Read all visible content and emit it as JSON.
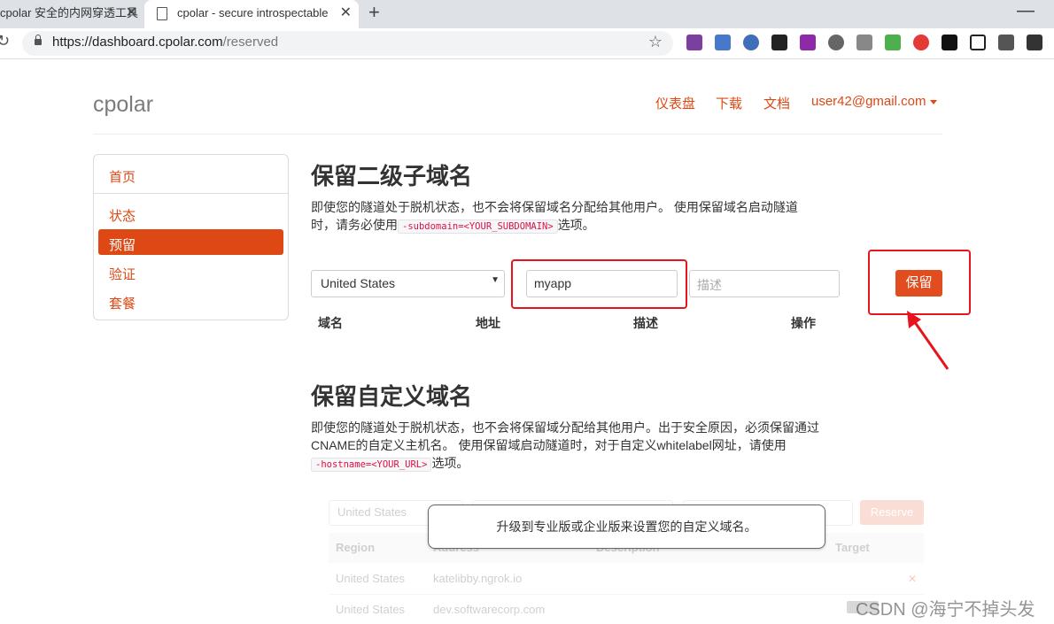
{
  "browser": {
    "tabs": [
      {
        "title": "cpolar 安全的内网穿透工具"
      },
      {
        "title": "cpolar - secure introspectable"
      }
    ],
    "url_host": "https://dashboard.cpolar.com",
    "url_path": "/reserved"
  },
  "header": {
    "brand": "cpolar",
    "nav": [
      "仪表盘",
      "下载",
      "文档"
    ],
    "user": "user42@gmail.com"
  },
  "sidebar": {
    "items": [
      "首页",
      "状态",
      "预留",
      "验证",
      "套餐"
    ],
    "active_index": 2
  },
  "reserved_subdomain": {
    "title": "保留二级子域名",
    "desc_line1": "即使您的隧道处于脱机状态，也不会将保留域名分配给其他用户。 使用保留域名启动隧道",
    "desc_line2_before": "时，请务必使用",
    "desc_code": "-subdomain=<YOUR_SUBDOMAIN>",
    "desc_line2_after": "选项。",
    "region_value": "United States",
    "name_value": "myapp",
    "desc_placeholder": "描述",
    "reserve_button": "保留",
    "columns": [
      "域名",
      "地址",
      "描述",
      "操作"
    ]
  },
  "reserved_custom": {
    "title": "保留自定义域名",
    "desc_line1": "即使您的隧道处于脱机状态，也不会将保留域分配给其他用户。出于安全原因，必须保留通过",
    "desc_line2": "CNAME的自定义主机名。 使用保留域启动隧道时，对于自定义whitelabel网址，请使用",
    "desc_code": "-hostname=<YOUR_URL>",
    "desc_line3_after": "选项。",
    "faded": {
      "region_value": "United States",
      "reserve_button": "Reserve",
      "columns": [
        "Region",
        "Address",
        "Description",
        "Target"
      ],
      "rows": [
        {
          "region": "United States",
          "address": "katelibby.ngrok.io"
        },
        {
          "region": "United States",
          "address": "dev.softwarecorp.com"
        }
      ]
    },
    "upgrade_notice": "升级到专业版或企业版来设置您的自定义域名。"
  },
  "watermark": "CSDN @海宁不掉头发"
}
